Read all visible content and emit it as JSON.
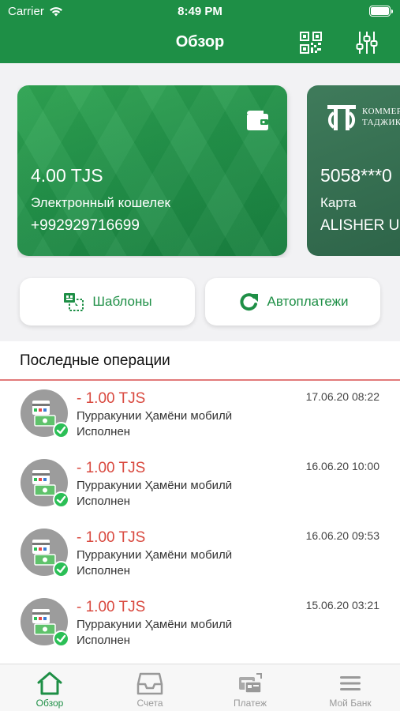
{
  "status_bar": {
    "carrier": "Carrier",
    "time": "8:49 PM"
  },
  "header": {
    "title": "Обзор"
  },
  "cards": [
    {
      "amount": "4.00 TJS",
      "subtitle": "Электронный кошелек",
      "number": "+992929716699"
    },
    {
      "bank_name_line1": "КОММЕРЧ",
      "bank_name_line2": "ТАДЖИКИ",
      "amount": "5058***0",
      "subtitle": "Карта",
      "number": "ALISHER US"
    }
  ],
  "quick_actions": {
    "templates_label": "Шаблоны",
    "autopay_label": "Автоплатежи"
  },
  "operations": {
    "title": "Последные операции",
    "items": [
      {
        "amount": "- 1.00 TJS",
        "description": "Пурракунии Ҳамёни мобилӣ",
        "status": "Исполнен",
        "date": "17.06.20 08:22"
      },
      {
        "amount": "- 1.00 TJS",
        "description": "Пурракунии Ҳамёни мобилӣ",
        "status": "Исполнен",
        "date": "16.06.20 10:00"
      },
      {
        "amount": "- 1.00 TJS",
        "description": "Пурракунии Ҳамёни мобилӣ",
        "status": "Исполнен",
        "date": "16.06.20 09:53"
      },
      {
        "amount": "- 1.00 TJS",
        "description": "Пурракунии Ҳамёни мобилӣ",
        "status": "Исполнен",
        "date": "15.06.20 03:21"
      }
    ]
  },
  "tabs": [
    {
      "label": "Обзор",
      "icon": "home-icon",
      "active": true
    },
    {
      "label": "Счета",
      "icon": "inbox-icon",
      "active": false
    },
    {
      "label": "Платеж",
      "icon": "payment-icon",
      "active": false
    },
    {
      "label": "Мой Банк",
      "icon": "menu-icon",
      "active": false
    }
  ],
  "colors": {
    "brand": "#1e8f46",
    "negative": "#d9493f",
    "success": "#2bbf56"
  }
}
